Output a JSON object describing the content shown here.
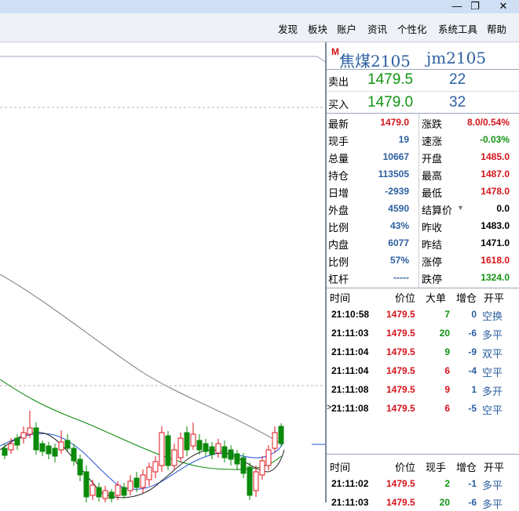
{
  "window": {
    "restore_glyph": "❐",
    "close_glyph": "✕",
    "minimize_glyph": "—"
  },
  "menu": [
    "发现",
    "板块",
    "账户",
    "资讯",
    "个性化",
    "系统工具",
    "帮助"
  ],
  "symbol": {
    "badge": "M",
    "name": "焦煤2105",
    "code": "jm2105"
  },
  "orderbook": {
    "sell": {
      "label": "卖出",
      "price": "1479.5",
      "qty": "22"
    },
    "buy": {
      "label": "买入",
      "price": "1479.0",
      "qty": "32"
    }
  },
  "stats_left": [
    {
      "label": "最新",
      "value": "1479.0",
      "color": "red"
    },
    {
      "label": "现手",
      "value": "19",
      "color": "blue"
    },
    {
      "label": "总量",
      "value": "10667",
      "color": "blue"
    },
    {
      "label": "持仓",
      "value": "113505",
      "color": "blue"
    },
    {
      "label": "日增",
      "value": "-2939",
      "color": "blue"
    },
    {
      "label": "外盘",
      "value": "4590",
      "color": "blue"
    },
    {
      "label": "比例",
      "value": "43%",
      "color": "blue"
    },
    {
      "label": "内盘",
      "value": "6077",
      "color": "blue"
    },
    {
      "label": "比例",
      "value": "57%",
      "color": "blue"
    },
    {
      "label": "杠杆",
      "value": "-----",
      "color": "blue"
    }
  ],
  "stats_right": [
    {
      "label": "涨跌",
      "value": "8.0/0.54%",
      "color": "red"
    },
    {
      "label": "速涨",
      "value": "-0.03%",
      "color": "green"
    },
    {
      "label": "开盘",
      "value": "1485.0",
      "color": "red"
    },
    {
      "label": "最高",
      "value": "1487.0",
      "color": "red"
    },
    {
      "label": "最低",
      "value": "1478.0",
      "color": "red"
    },
    {
      "label": "结算价",
      "value": "0.0",
      "color": "black",
      "dropdown": true
    },
    {
      "label": "昨收",
      "value": "1483.0",
      "color": "black"
    },
    {
      "label": "昨结",
      "value": "1471.0",
      "color": "black"
    },
    {
      "label": "涨停",
      "value": "1618.0",
      "color": "red"
    },
    {
      "label": "跌停",
      "value": "1324.0",
      "color": "green"
    }
  ],
  "trades1": {
    "headers": [
      "时间",
      "价位",
      "大单",
      "增仓",
      "开平"
    ],
    "rows": [
      {
        "time": "21:10:58",
        "price": "1479.5",
        "vol": "7",
        "vol_color": "green",
        "chg": "0",
        "type": "空换",
        "marker": ""
      },
      {
        "time": "21:11:03",
        "price": "1479.5",
        "vol": "20",
        "vol_color": "green",
        "chg": "-6",
        "type": "多平",
        "marker": ""
      },
      {
        "time": "21:11:04",
        "price": "1479.5",
        "vol": "9",
        "vol_color": "green",
        "chg": "-9",
        "type": "双平",
        "marker": ""
      },
      {
        "time": "21:11:04",
        "price": "1479.5",
        "vol": "6",
        "vol_color": "red",
        "chg": "-4",
        "type": "空平",
        "marker": ""
      },
      {
        "time": "21:11:08",
        "price": "1479.5",
        "vol": "9",
        "vol_color": "red",
        "chg": "1",
        "type": "多开",
        "marker": ""
      },
      {
        "time": "21:11:08",
        "price": "1479.5",
        "vol": "6",
        "vol_color": "red",
        "chg": "-5",
        "type": "空平",
        "marker": ">"
      }
    ]
  },
  "trades2": {
    "headers": [
      "时间",
      "价位",
      "现手",
      "增仓",
      "开平"
    ],
    "rows": [
      {
        "time": "21:11:02",
        "price": "1479.5",
        "vol": "2",
        "vol_color": "green",
        "chg": "-1",
        "type": "多平"
      },
      {
        "time": "21:11:03",
        "price": "1479.5",
        "vol": "20",
        "vol_color": "green",
        "chg": "-6",
        "type": "多平"
      }
    ]
  },
  "chart_data": {
    "type": "candlestick",
    "note_colors": {
      "up": "#e0141b",
      "down": "#0a8a0a",
      "ma1": "#222222",
      "ma2": "#2050d8",
      "ma3": "#0a8a0a",
      "ma4": "#777777"
    }
  }
}
